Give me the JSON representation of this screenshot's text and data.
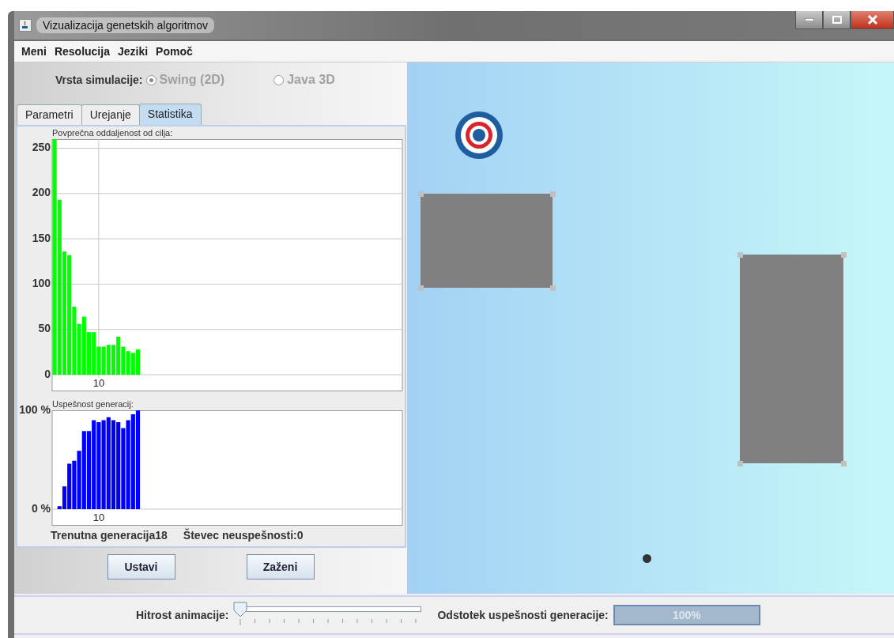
{
  "window": {
    "title": "Vizualizacija genetskih algoritmov"
  },
  "menu": [
    "Meni",
    "Resolucija",
    "Jeziki",
    "Pomoč"
  ],
  "simulation_type": {
    "label": "Vrsta simulacije:",
    "options": [
      {
        "label": "Swing (2D)",
        "selected": true,
        "disabled": true
      },
      {
        "label": "Java 3D",
        "selected": false,
        "disabled": true
      }
    ]
  },
  "tabs": [
    {
      "label": "Parametri",
      "selected": false
    },
    {
      "label": "Urejanje",
      "selected": false
    },
    {
      "label": "Statistika",
      "selected": true
    }
  ],
  "charts": [
    {
      "title": "Povprečna oddaljenost od cilja:",
      "chart_data": {
        "type": "bar",
        "grid": true,
        "series": [
          {
            "color": "#00ff00",
            "values": [
              260,
              193,
              136,
              132,
              75,
              56,
              64,
              47,
              47,
              31,
              31,
              33,
              33,
              42,
              31,
              26,
              24,
              28
            ]
          }
        ],
        "ylim": [
          0,
          260
        ],
        "yticks": [
          0,
          50,
          100,
          150,
          200,
          250
        ],
        "annotations": [
          "10"
        ]
      }
    },
    {
      "title": "Uspešnost generacij:",
      "chart_data": {
        "type": "bar",
        "grid": false,
        "series": [
          {
            "color": "#0000ff",
            "values": [
              null,
              3,
              23,
              46,
              49,
              59,
              79,
              79,
              90,
              88,
              90,
              93,
              90,
              88,
              82,
              90,
              96,
              100
            ]
          }
        ],
        "ylim": [
          0,
          100
        ],
        "yticks": [
          {
            "value": 0,
            "label": "0 %"
          },
          {
            "value": 100,
            "label": "100 %"
          }
        ],
        "annotations": [
          "10"
        ]
      }
    }
  ],
  "stats": [
    "Trenutna generacija18",
    "Števec neuspešnosti:0"
  ],
  "buttons": [
    "Ustavi",
    "Zaženi"
  ],
  "bottom_bar": {
    "speed": {
      "label": "Hitrost animacije:",
      "level": 0.0
    },
    "success": {
      "label": "Odstotek uspešnosti generacije:",
      "text": "100%",
      "level": 1.0
    }
  }
}
